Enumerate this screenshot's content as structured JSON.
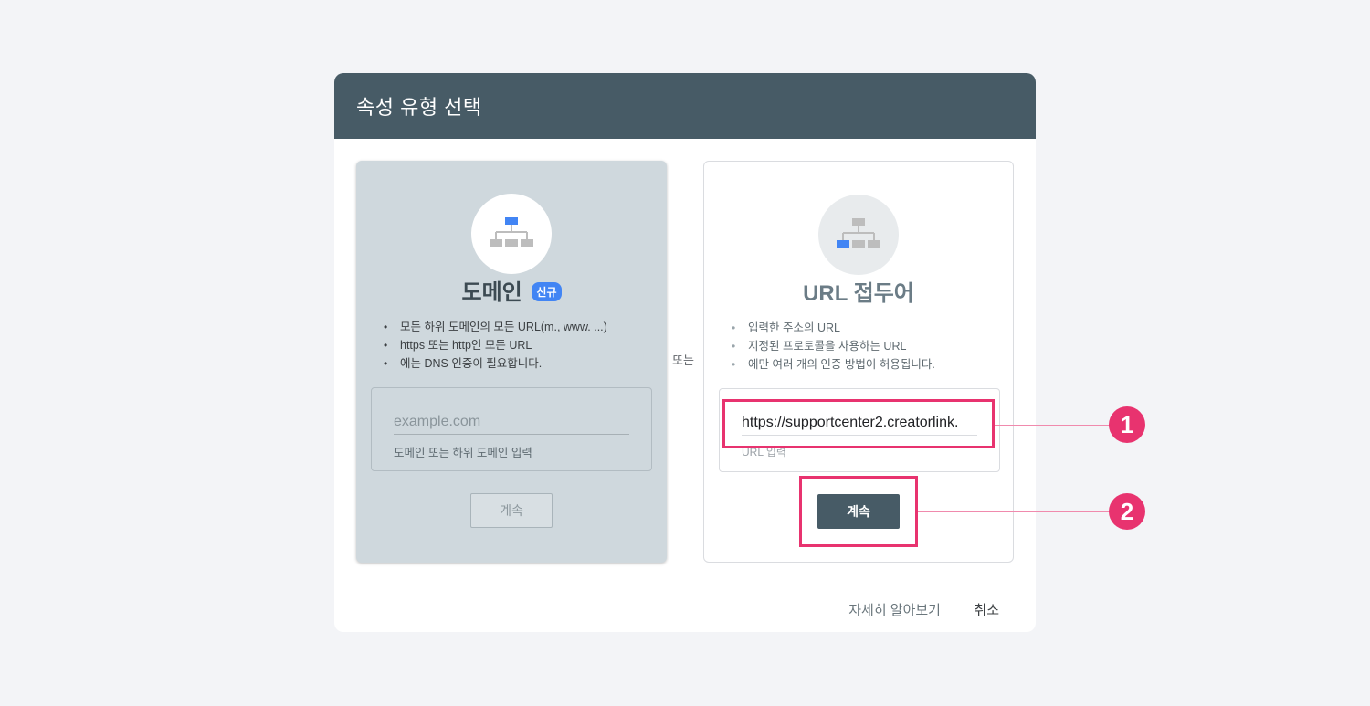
{
  "dialog": {
    "title": "속성 유형 선택",
    "or_label": "또는"
  },
  "domain_card": {
    "icon": "sitemap-icon",
    "title": "도메인",
    "badge": "신규",
    "bullets": [
      "모든 하위 도메인의 모든 URL(m., www. ...)",
      "https 또는 http인 모든 URL",
      "에는 DNS 인증이 필요합니다."
    ],
    "input_placeholder": "example.com",
    "input_helper": "도메인 또는 하위 도메인 입력",
    "continue_label": "계속"
  },
  "url_card": {
    "icon": "sitemap-icon",
    "title": "URL 접두어",
    "bullets": [
      "입력한 주소의 URL",
      "지정된 프로토콜을 사용하는 URL",
      "에만 여러 개의 인증 방법이 허용됩니다."
    ],
    "input_value": "https://supportcenter2.creatorlink.",
    "input_helper": "URL 입력",
    "continue_label": "계속"
  },
  "footer": {
    "learn_more": "자세히 알아보기",
    "cancel": "취소"
  },
  "callouts": [
    "1",
    "2"
  ],
  "colors": {
    "header": "#475b66",
    "accent": "#e8336f",
    "badge": "#4285f4",
    "icon_active": "#4285f4",
    "icon_inactive": "#bdbdbd"
  }
}
